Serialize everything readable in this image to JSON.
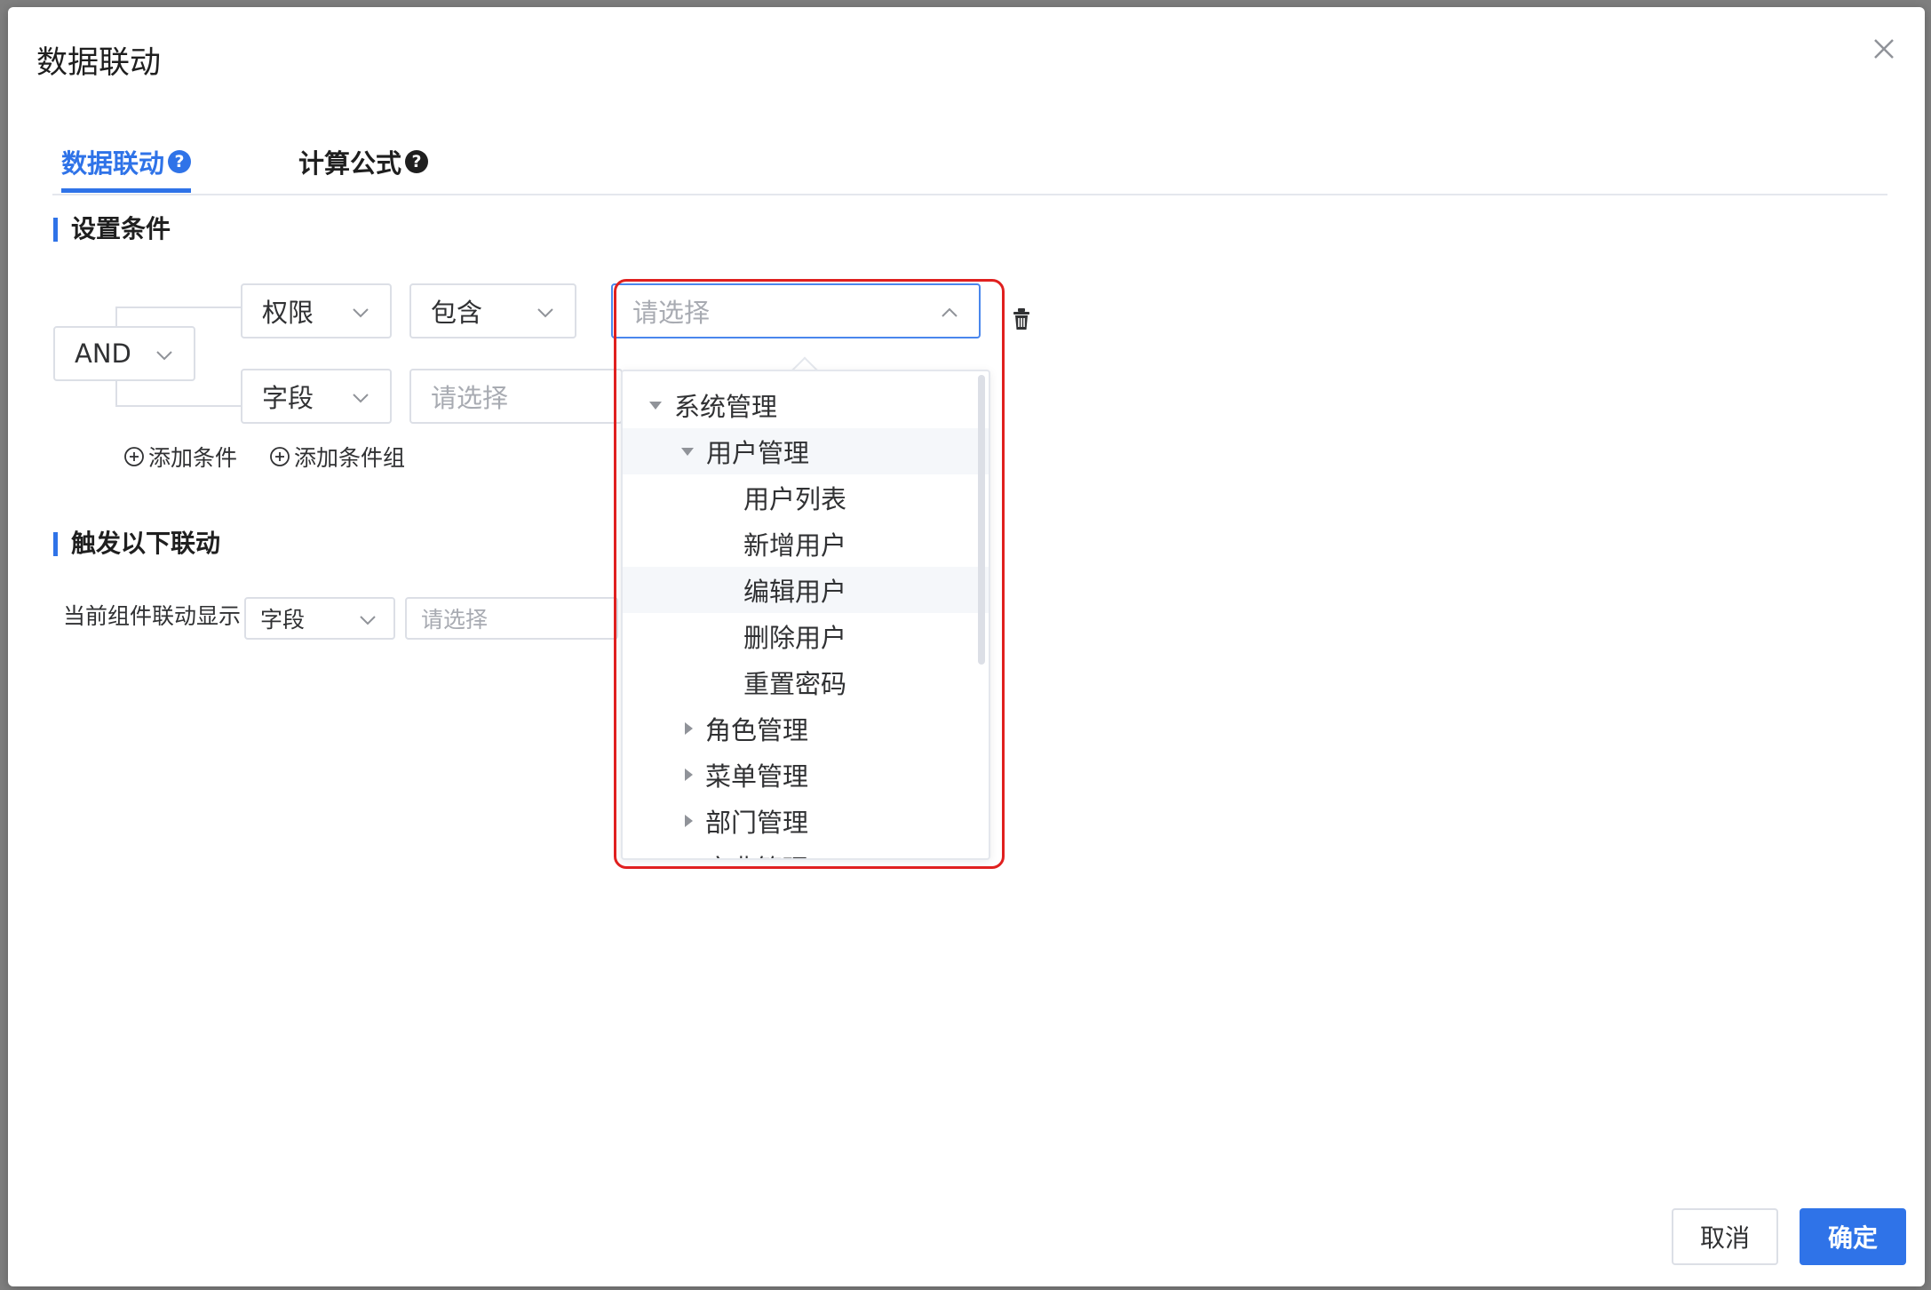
{
  "modal": {
    "title": "数据联动"
  },
  "tabs": [
    {
      "label": "数据联动",
      "active": true
    },
    {
      "label": "计算公式",
      "active": false
    }
  ],
  "conditions": {
    "section_title": "设置条件",
    "logic": "AND",
    "rows": [
      {
        "field": "权限",
        "operator": "包含",
        "value_placeholder": "请选择"
      },
      {
        "field": "字段",
        "value_placeholder": "请选择"
      }
    ],
    "add_condition": "添加条件",
    "add_condition_group": "添加条件组"
  },
  "trigger": {
    "section_title": "触发以下联动",
    "label": "当前组件联动显示",
    "field": "字段",
    "value_placeholder": "请选择"
  },
  "tree": [
    {
      "label": "系统管理",
      "level": 0,
      "expanded": true
    },
    {
      "label": "用户管理",
      "level": 1,
      "expanded": true,
      "highlighted": true
    },
    {
      "label": "用户列表",
      "level": 2
    },
    {
      "label": "新增用户",
      "level": 2
    },
    {
      "label": "编辑用户",
      "level": 2,
      "highlighted": true
    },
    {
      "label": "删除用户",
      "level": 2
    },
    {
      "label": "重置密码",
      "level": 2
    },
    {
      "label": "角色管理",
      "level": 1,
      "expanded": false
    },
    {
      "label": "菜单管理",
      "level": 1,
      "expanded": false
    },
    {
      "label": "部门管理",
      "level": 1,
      "expanded": false
    },
    {
      "label": "字典管理",
      "level": 1,
      "expanded": false
    }
  ],
  "footer": {
    "cancel": "取消",
    "confirm": "确定"
  },
  "colors": {
    "accent": "#2f73e8",
    "highlight_outline": "#e0201f"
  },
  "icons": [
    "close-icon",
    "question-icon",
    "chevron-down-icon",
    "chevron-up-icon",
    "trash-icon",
    "plus-circle-icon",
    "caret-down-icon",
    "caret-right-icon"
  ]
}
